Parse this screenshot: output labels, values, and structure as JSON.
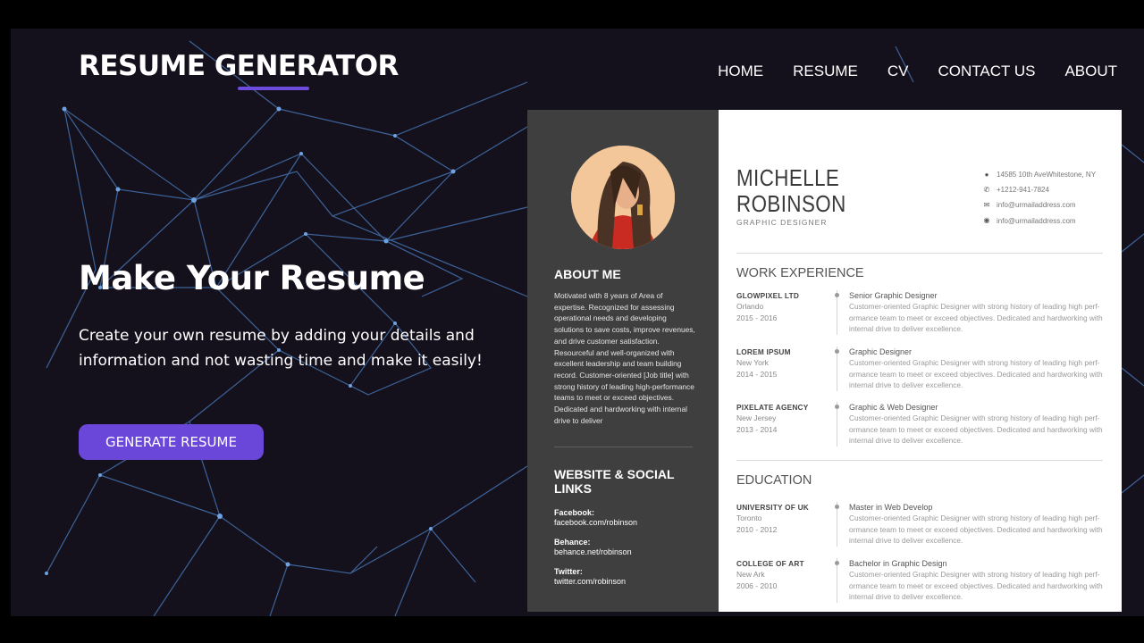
{
  "header": {
    "brand": "RESUME GENERATOR",
    "nav": [
      "HOME",
      "RESUME",
      "CV",
      "CONTACT US",
      "ABOUT"
    ]
  },
  "hero": {
    "title": "Make Your Resume",
    "description": "Create your own resume by adding your details and information and not wasting time and make it easily!",
    "cta": "GENERATE RESUME"
  },
  "resume": {
    "name_first": "MICHELLE",
    "name_last": "ROBINSON",
    "role": "GRAPHIC DESIGNER",
    "contact": [
      {
        "icon": "location-pin-icon",
        "text": "14585 10th AveWhitestone, NY"
      },
      {
        "icon": "phone-icon",
        "text": "+1212-941-7824"
      },
      {
        "icon": "mail-icon",
        "text": "info@urmailaddress.com"
      },
      {
        "icon": "globe-icon",
        "text": "info@urmailaddress.com"
      }
    ],
    "about_title": "ABOUT ME",
    "about_text": "Motivated with 8 years of Area of expertise. Recognized for assessing operational needs and developing solutions to save costs, improve revenues, and drive customer satisfaction. Resourceful and well-organized with excellent leadership and team building record. Customer-oriented [Job title] with strong history of leading high-performance teams to meet or exceed objectives. Dedicated and hardworking with internal drive to deliver",
    "social_title": "WEBSITE & SOCIAL LINKS",
    "social": [
      {
        "label": "Facebook:",
        "value": "facebook.com/robinson"
      },
      {
        "label": "Behance:",
        "value": "behance.net/robinson"
      },
      {
        "label": "Twitter:",
        "value": "twitter.com/robinson"
      }
    ],
    "work_title": "WORK EXPERIENCE",
    "work": [
      {
        "company": "GLOWPIXEL LTD",
        "city": "Orlando",
        "years": "2015 - 2016",
        "title": "Senior Graphic Designer",
        "desc": "Customer-oriented Graphic Designer with strong history of leading high perf-ormance team to meet or exceed objectives. Dedicated and hardworking with internal drive to deliver excellence."
      },
      {
        "company": "LOREM IPSUM",
        "city": "New York",
        "years": "2014 - 2015",
        "title": "Graphic Designer",
        "desc": "Customer-oriented Graphic Designer with strong history of leading high perf-ormance team to meet or exceed objectives. Dedicated and hardworking with internal drive to deliver excellence."
      },
      {
        "company": "PIXELATE AGENCY",
        "city": "New Jersey",
        "years": "2013 - 2014",
        "title": "Graphic & Web Designer",
        "desc": "Customer-oriented Graphic Designer with strong history of leading high perf-ormance team to meet or exceed objectives. Dedicated and hardworking with internal drive to deliver excellence."
      }
    ],
    "education_title": "EDUCATION",
    "education": [
      {
        "school": "UNIVERSITY OF UK",
        "city": "Toronto",
        "years": "2010 - 2012",
        "title": "Master in Web Develop",
        "desc": "Customer-oriented Graphic Designer with strong history of leading high perf-ormance team to meet or exceed objectives. Dedicated and hardworking with internal drive to deliver excellence."
      },
      {
        "school": "COLLEGE OF ART",
        "city": "New Ark",
        "years": "2006 - 2010",
        "title": "Bachelor in Graphic Design",
        "desc": "Customer-oriented Graphic Designer with strong history of leading high perf-ormance team to meet or exceed objectives. Dedicated and hardworking with internal drive to deliver excellence."
      }
    ]
  },
  "colors": {
    "background": "#15111c",
    "accent": "#6a46d9",
    "network_lines": "#4a7fc4",
    "resume_sidebar": "#3f3f3f"
  }
}
